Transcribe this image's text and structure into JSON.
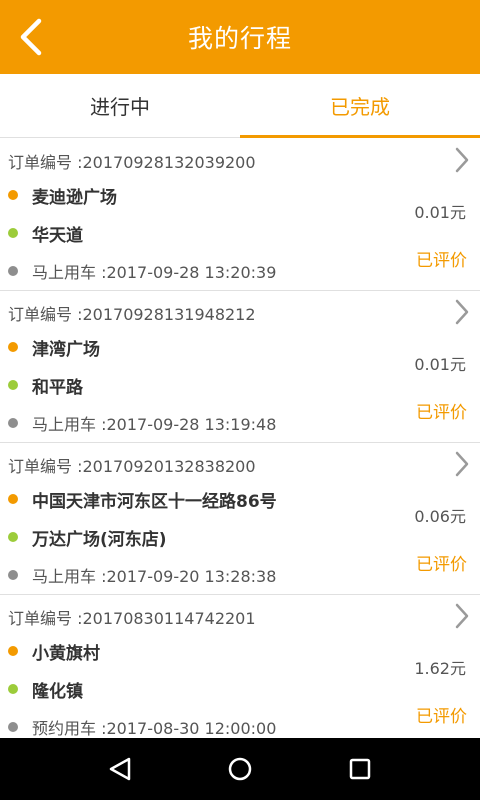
{
  "header": {
    "title": "我的行程"
  },
  "tabs": [
    {
      "label": "进行中",
      "active": false
    },
    {
      "label": "已完成",
      "active": true
    }
  ],
  "orders": [
    {
      "order_label": "订单编号 :20170928132039200",
      "from": "麦迪逊广场",
      "to": "华天道",
      "time": "马上用车 :2017-09-28 13:20:39",
      "price": "0.01元",
      "status": "已评价"
    },
    {
      "order_label": "订单编号 :20170928131948212",
      "from": "津湾广场",
      "to": "和平路",
      "time": "马上用车 :2017-09-28 13:19:48",
      "price": "0.01元",
      "status": "已评价"
    },
    {
      "order_label": "订单编号 :20170920132838200",
      "from": "中国天津市河东区十一经路86号",
      "to": "万达广场(河东店)",
      "time": "马上用车 :2017-09-20 13:28:38",
      "price": "0.06元",
      "status": "已评价"
    },
    {
      "order_label": "订单编号 :20170830114742201",
      "from": "小黄旗村",
      "to": "隆化镇",
      "time": "预约用车 :2017-08-30 12:00:00",
      "price": "1.62元",
      "status": "已评价"
    }
  ],
  "colors": {
    "accent": "#f39a00",
    "from_dot": "#f39a00",
    "to_dot": "#9ccc3a",
    "time_dot": "#8e8e8e"
  },
  "icons": {
    "back": "chevron-left-icon",
    "detail": "chevron-right-icon",
    "nav": [
      "back-triangle-icon",
      "home-circle-icon",
      "recents-square-icon"
    ]
  }
}
